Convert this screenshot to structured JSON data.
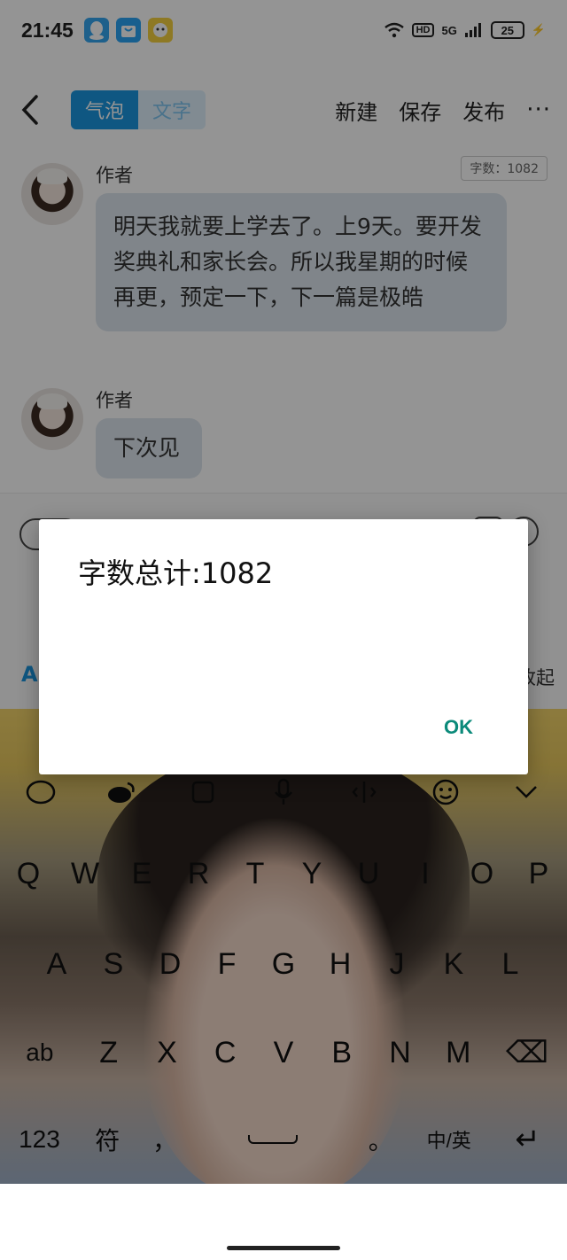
{
  "status_bar": {
    "time": "21:45",
    "network": "5G",
    "hd": "HD",
    "battery": "25"
  },
  "topbar": {
    "tab_bubble": "气泡",
    "tab_text": "文字",
    "new_label": "新建",
    "save_label": "保存",
    "publish_label": "发布",
    "more_label": "···"
  },
  "messages": [
    {
      "author": "作者",
      "text": "明天我就要上学去了。上9天。要开发奖典礼和家长会。所以我星期的时候再更，预定一下，下一篇是极皓"
    },
    {
      "author": "作者",
      "text": "下次见"
    }
  ],
  "word_count_badge": "字数：1082",
  "editor_strip": {
    "left_label": "A",
    "right_label": "收起"
  },
  "dialog": {
    "message": "字数总计:1082",
    "ok_label": "OK"
  },
  "keyboard": {
    "row1": [
      "Q",
      "W",
      "E",
      "R",
      "T",
      "Y",
      "U",
      "I",
      "O",
      "P"
    ],
    "row2": [
      "A",
      "S",
      "D",
      "F",
      "G",
      "H",
      "J",
      "K",
      "L"
    ],
    "row3": [
      "ab",
      "Z",
      "X",
      "C",
      "V",
      "B",
      "N",
      "M",
      "⌫"
    ],
    "row4": [
      "123",
      "符",
      "，",
      "",
      "。",
      "中/英",
      "↵"
    ]
  },
  "colors": {
    "accent": "#1a96e0",
    "dialog_button": "#0b8a7a",
    "bubble_bg": "#dde6ee"
  }
}
